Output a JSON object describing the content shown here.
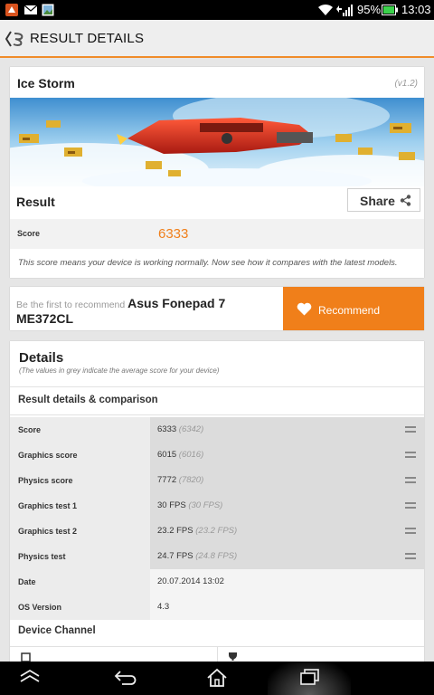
{
  "status_bar": {
    "battery_percent": "95%",
    "time": "13:03",
    "left_icons": [
      "app-notification-icon",
      "mail-icon",
      "image-icon"
    ],
    "right_icons": [
      "wifi-icon",
      "signal-icon",
      "battery-icon"
    ]
  },
  "app_bar": {
    "title": "RESULT DETAILS",
    "logo_icon": "3dmark-logo-icon"
  },
  "benchmark": {
    "name": "Ice Storm",
    "version": "(v1.2)",
    "result_label": "Result",
    "share_label": "Share",
    "score_label": "Score",
    "score_value": "6333",
    "note": "This score means your device is working normally. Now see how it compares with the latest models."
  },
  "recommend": {
    "prompt": "Be the first to recommend",
    "device": "Asus Fonepad 7 ME372CL",
    "button_label": "Recommend"
  },
  "details": {
    "title": "Details",
    "subtitle": "(The values in grey indicate the average score for your device)",
    "section_title": "Result details & comparison",
    "rows": [
      {
        "label": "Score",
        "value": "6333",
        "avg": "(6342)",
        "has_bar": true
      },
      {
        "label": "Graphics score",
        "value": "6015",
        "avg": "(6016)",
        "has_bar": true
      },
      {
        "label": "Physics score",
        "value": "7772",
        "avg": "(7820)",
        "has_bar": true
      },
      {
        "label": "Graphics test 1",
        "value": "30 FPS",
        "avg": "(30 FPS)",
        "has_bar": true
      },
      {
        "label": "Graphics test 2",
        "value": "23.2 FPS",
        "avg": "(23.2 FPS)",
        "has_bar": true
      },
      {
        "label": "Physics test",
        "value": "24.7 FPS",
        "avg": "(24.8 FPS)",
        "has_bar": true
      },
      {
        "label": "Date",
        "value": "20.07.2014 13:02",
        "avg": "",
        "has_bar": false
      },
      {
        "label": "OS Version",
        "value": "4.3",
        "avg": "",
        "has_bar": false
      }
    ],
    "device_channel_title": "Device Channel"
  },
  "nav_bar": {
    "buttons": [
      "collapse-icon",
      "back-icon",
      "home-icon",
      "recent-apps-icon"
    ]
  },
  "colors": {
    "accent": "#f07f1a",
    "divider_orange": "#f08c2a"
  }
}
